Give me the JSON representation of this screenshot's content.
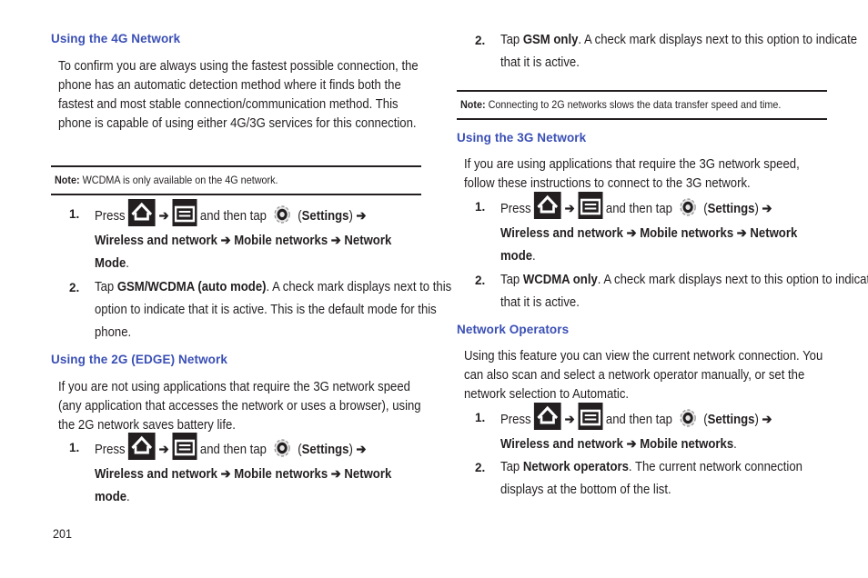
{
  "page_number": "201",
  "icons": {
    "home": "home-icon",
    "menu": "menu-icon",
    "settings": "gear-icon",
    "arrow": "➔"
  },
  "left": {
    "section_4g": {
      "heading": "Using the 4G Network",
      "paragraph": "To confirm you are always using the fastest possible connection, the phone has an automatic detection method where it finds both the fastest and most stable connection/communication method. This phone is capable of using either 4G/3G services for this connection.",
      "note_label": "Note:",
      "note_text": " WCDMA is only available on the 4G network.",
      "steps": [
        {
          "num": "1.",
          "press": "Press",
          "and_then_tap": " and then tap ",
          "settings_open": " (",
          "settings": "Settings",
          "settings_close": ") ",
          "path": "Wireless and network ➔ Mobile networks  ➔ Network Mode",
          "end": "."
        },
        {
          "num": "2.",
          "tap": "Tap ",
          "option": "GSM/WCDMA (auto mode)",
          "rest": ". A check mark displays next to this option to indicate that it is active. This is the default mode for this phone."
        }
      ]
    },
    "section_2g": {
      "heading": "Using the 2G (EDGE) Network",
      "paragraph": "If you are not using applications that require the 3G network speed (any application that accesses the network or uses a browser), using the 2G network saves battery life.",
      "steps": [
        {
          "num": "1.",
          "press": "Press",
          "and_then_tap": " and then tap ",
          "settings_open": " (",
          "settings": "Settings",
          "settings_close": ") ",
          "path": "Wireless and network ➔ Mobile networks  ➔ Network mode",
          "end": "."
        }
      ]
    }
  },
  "right": {
    "section_2g_cont": {
      "steps": [
        {
          "num": "2.",
          "tap": "Tap ",
          "option": "GSM only",
          "rest": ". A check mark displays next to this option to indicate that it is active."
        }
      ],
      "note_label": "Note:",
      "note_text": " Connecting to 2G networks slows the data transfer speed and time."
    },
    "section_3g": {
      "heading": "Using the 3G Network",
      "paragraph": "If you are using applications that require the 3G network speed, follow these instructions to connect to the 3G network.",
      "steps": [
        {
          "num": "1.",
          "press": "Press",
          "and_then_tap": " and then tap ",
          "settings_open": " (",
          "settings": "Settings",
          "settings_close": ") ",
          "path": "Wireless and network ➔ Mobile networks  ➔ Network mode",
          "end": "."
        },
        {
          "num": "2.",
          "tap": "Tap ",
          "option": "WCDMA only",
          "rest": ". A check mark displays next to this option to indicate that it is active."
        }
      ]
    },
    "section_operators": {
      "heading": "Network Operators",
      "paragraph": "Using this feature you can view the current network connection. You can also scan and select a network operator manually, or set the network selection to Automatic.",
      "steps": [
        {
          "num": "1.",
          "press": "Press",
          "and_then_tap": " and then tap ",
          "settings_open": " (",
          "settings": "Settings",
          "settings_close": ") ",
          "path": "Wireless and network ➔ Mobile networks",
          "end": "."
        },
        {
          "num": "2.",
          "tap": "Tap ",
          "option": "Network operators",
          "rest": ". The current network connection displays at the bottom of the list."
        }
      ]
    }
  }
}
